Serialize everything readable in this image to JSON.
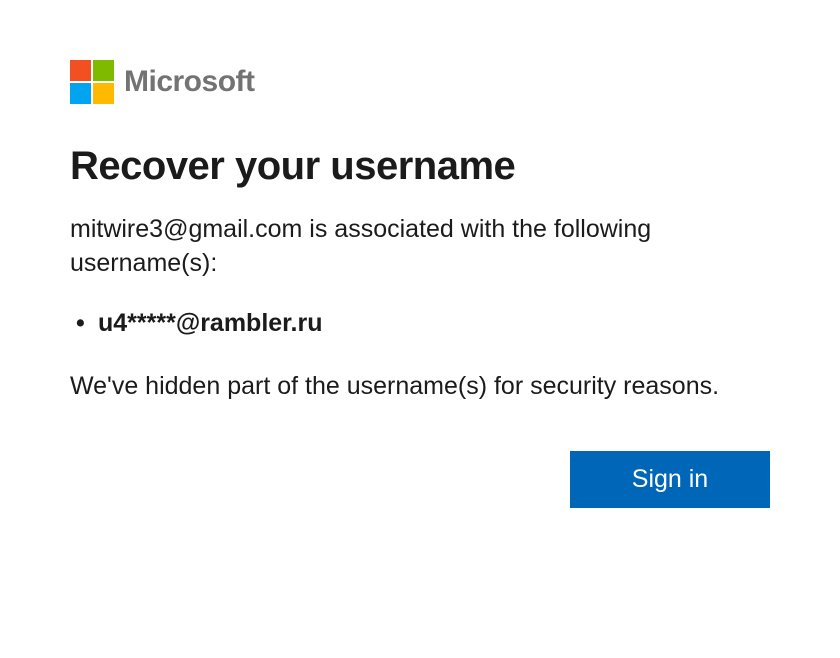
{
  "brand": {
    "name": "Microsoft",
    "colors": {
      "sq1": "#f25022",
      "sq2": "#7fba00",
      "sq3": "#00a4ef",
      "sq4": "#ffb900"
    }
  },
  "page": {
    "title": "Recover your username",
    "intro": "mitwire3@gmail.com is associated with the following username(s):",
    "usernames": [
      "u4*****@rambler.ru"
    ],
    "hidden_note": "We've hidden part of the username(s) for security reasons."
  },
  "actions": {
    "signin_label": "Sign in"
  }
}
